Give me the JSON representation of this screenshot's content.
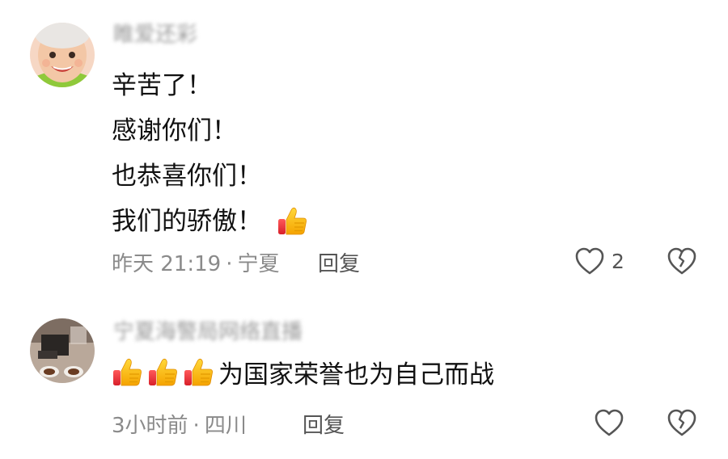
{
  "comments": [
    {
      "username": "睢爱还彩",
      "body_lines": [
        "辛苦了！",
        "感谢你们！",
        "也恭喜你们！",
        "我们的骄傲！"
      ],
      "time": "昨天 21:19",
      "location": "宁夏",
      "separator": "·",
      "reply_label": "回复",
      "like_count": "2",
      "emoji": "thumbs-up"
    },
    {
      "username": "宁夏海警局网络直播",
      "body_text": "为国家荣誉也为自己而战",
      "emoji_prefix": [
        "thumbs-up",
        "thumbs-up",
        "thumbs-up"
      ],
      "time": "3小时前",
      "location": "四川",
      "separator": "·",
      "reply_label": "回复",
      "like_count": ""
    }
  ],
  "colors": {
    "meta": "#8a8a8a",
    "reply": "#555555",
    "icon": "#555555"
  }
}
